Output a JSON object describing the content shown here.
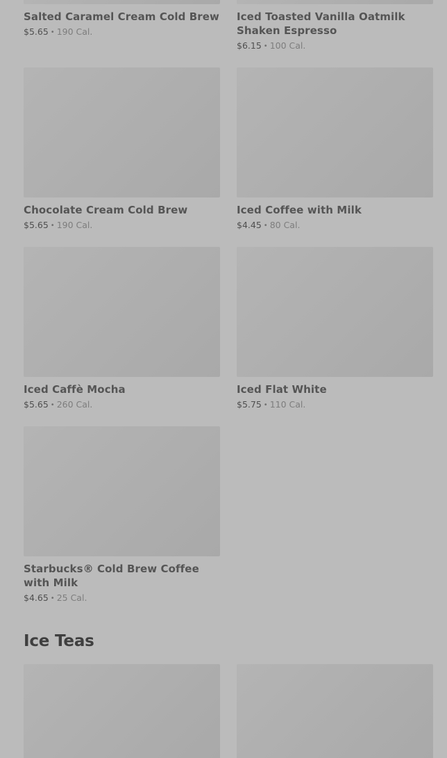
{
  "products": [
    {
      "name": "Salted Caramel Cream Cold Brew",
      "price": "$5.65",
      "separator": "•",
      "calories": "190 Cal."
    },
    {
      "name": "Iced Toasted Vanilla Oatmilk Shaken Espresso",
      "price": "$6.15",
      "separator": "•",
      "calories": "100 Cal."
    },
    {
      "name": "Chocolate Cream Cold Brew",
      "price": "$5.65",
      "separator": "•",
      "calories": "190 Cal."
    },
    {
      "name": "Iced Coffee with Milk",
      "price": "$4.45",
      "separator": "•",
      "calories": "80 Cal."
    },
    {
      "name": "Iced Caffè Mocha",
      "price": "$5.65",
      "separator": "•",
      "calories": "260 Cal."
    },
    {
      "name": "Iced Flat White",
      "price": "$5.75",
      "separator": "•",
      "calories": "110 Cal."
    },
    {
      "name": "Starbucks® Cold Brew Coffee with Milk",
      "price": "$4.65",
      "separator": "•",
      "calories": "25 Cal."
    }
  ],
  "sections": [
    {
      "title": "Ice Teas"
    }
  ]
}
